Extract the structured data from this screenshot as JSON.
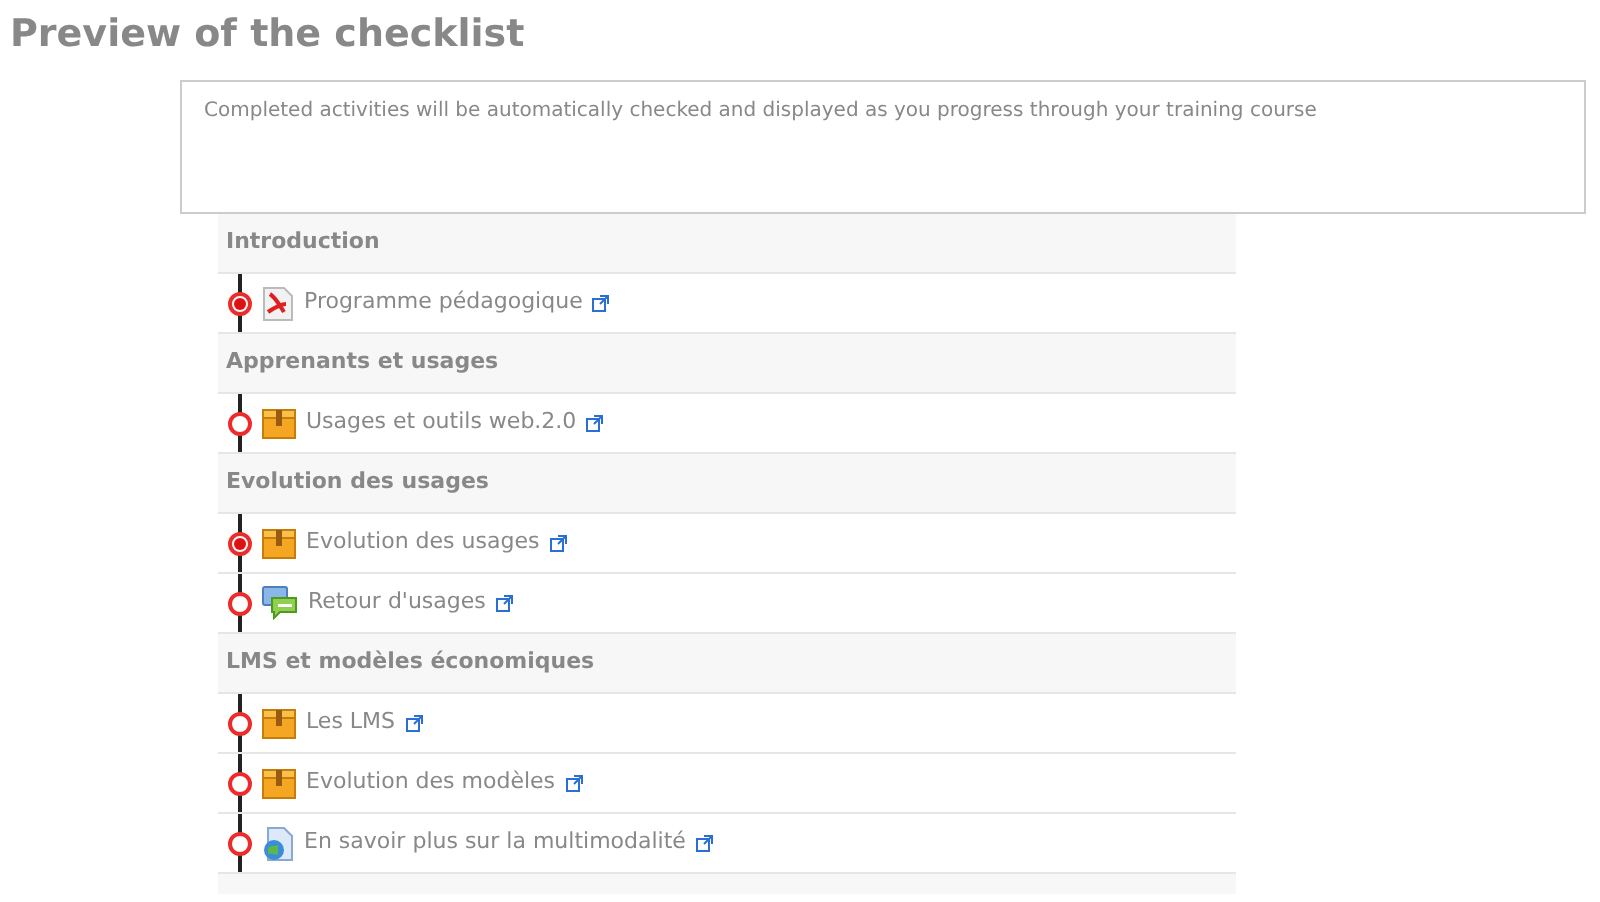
{
  "title": "Preview of the checklist",
  "notice": "Completed activities will be automatically checked and displayed as you progress through your training course",
  "sections": [
    {
      "name": "Introduction",
      "items": [
        {
          "label": "Programme pédagogique",
          "kind": "pdf",
          "completed": true
        }
      ]
    },
    {
      "name": "Apprenants et usages",
      "items": [
        {
          "label": "Usages et outils web.2.0",
          "kind": "package",
          "completed": false
        }
      ]
    },
    {
      "name": "Evolution des usages",
      "items": [
        {
          "label": "Evolution des usages",
          "kind": "package",
          "completed": true
        },
        {
          "label": "Retour d'usages",
          "kind": "forum",
          "completed": false
        }
      ]
    },
    {
      "name": "LMS et modèles économiques",
      "items": [
        {
          "label": "Les LMS",
          "kind": "package",
          "completed": false
        },
        {
          "label": "Evolution des modèles",
          "kind": "package",
          "completed": false
        },
        {
          "label": "En savoir plus sur la multimodalité",
          "kind": "page",
          "completed": false
        }
      ]
    }
  ]
}
